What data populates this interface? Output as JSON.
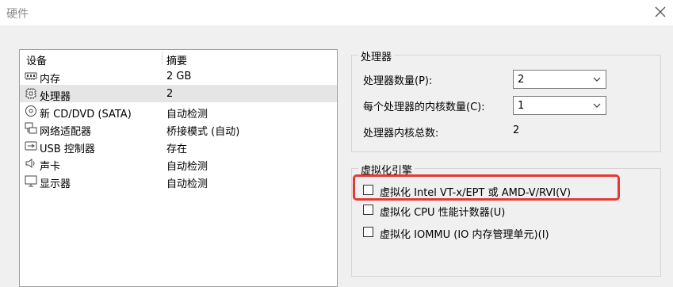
{
  "window": {
    "title": "硬件"
  },
  "device_list": {
    "headers": {
      "device": "设备",
      "summary": "摘要"
    },
    "items": [
      {
        "icon": "memory-icon",
        "name": "内存",
        "summary": "2 GB"
      },
      {
        "icon": "cpu-icon",
        "name": "处理器",
        "summary": "2",
        "selected": true
      },
      {
        "icon": "cd-dvd-icon",
        "name": "新 CD/DVD (SATA)",
        "summary": "自动检测"
      },
      {
        "icon": "network-adapter-icon",
        "name": "网络适配器",
        "summary": "桥接模式 (自动)"
      },
      {
        "icon": "usb-icon",
        "name": "USB 控制器",
        "summary": "存在"
      },
      {
        "icon": "sound-icon",
        "name": "声卡",
        "summary": "自动检测"
      },
      {
        "icon": "display-icon",
        "name": "显示器",
        "summary": "自动检测"
      }
    ]
  },
  "processor": {
    "group_title": "处理器",
    "count_label": "处理器数量(P):",
    "count_value": "2",
    "cores_label": "每个处理器的内核数量(C):",
    "cores_value": "1",
    "total_label": "处理器内核总数:",
    "total_value": "2"
  },
  "virtualization": {
    "group_title": "虚拟化引擎",
    "options": [
      {
        "label": "虚拟化 Intel VT-x/EPT 或 AMD-V/RVI(V)",
        "checked": false
      },
      {
        "label": "虚拟化 CPU 性能计数器(U)",
        "checked": false
      },
      {
        "label": "虚拟化 IOMMU (IO 内存管理单元)(I)",
        "checked": false
      }
    ]
  },
  "colors": {
    "highlight": "#e53935",
    "selected_row": "#e5e5e5"
  }
}
